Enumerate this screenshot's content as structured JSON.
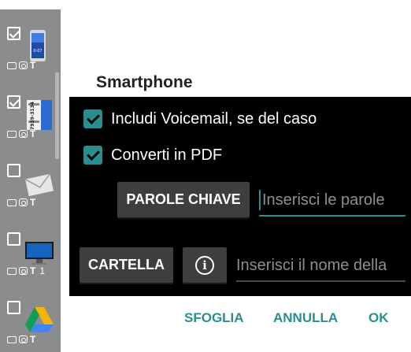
{
  "left_panel": {
    "items": [
      {
        "checked": true,
        "thumb": "phone-thumbnail",
        "icons": [
          "image-icon",
          "camera-icon",
          "text-icon"
        ],
        "extra": ""
      },
      {
        "checked": true,
        "thumb": "card-thumbnail",
        "icons": [
          "image-icon",
          "camera-icon",
          "text-icon"
        ],
        "extra": "",
        "card_text": "7939-3134"
      },
      {
        "checked": false,
        "thumb": "envelope-thumbnail",
        "icons": [
          "image-icon",
          "camera-icon",
          "text-icon"
        ],
        "extra": ""
      },
      {
        "checked": false,
        "thumb": "monitor-thumbnail",
        "icons": [
          "image-icon",
          "camera-icon",
          "text-icon"
        ],
        "extra": "1"
      },
      {
        "checked": false,
        "thumb": "drive-thumbnail",
        "icons": [
          "image-icon",
          "camera-icon",
          "text-icon"
        ],
        "extra": ""
      }
    ],
    "text_icon_glyph": "T"
  },
  "dialog": {
    "title": "Smartphone",
    "options": [
      {
        "label": "Includi Voicemail, se del caso",
        "checked": true
      },
      {
        "label": "Converti in PDF",
        "checked": true
      }
    ],
    "keywords": {
      "button_label": "PAROLE CHIAVE",
      "placeholder": "Inserisci le parole"
    },
    "folder": {
      "button_label": "CARTELLA",
      "info_glyph": "i",
      "placeholder": "Inserisci il nome della"
    },
    "actions": {
      "browse": "SFOGLIA",
      "cancel": "ANNULLA",
      "ok": "OK"
    }
  },
  "colors": {
    "accent": "#2a8e8f",
    "dialog_body": "#000000",
    "button": "#3e3e3e",
    "strip": "#8a8c8e"
  }
}
